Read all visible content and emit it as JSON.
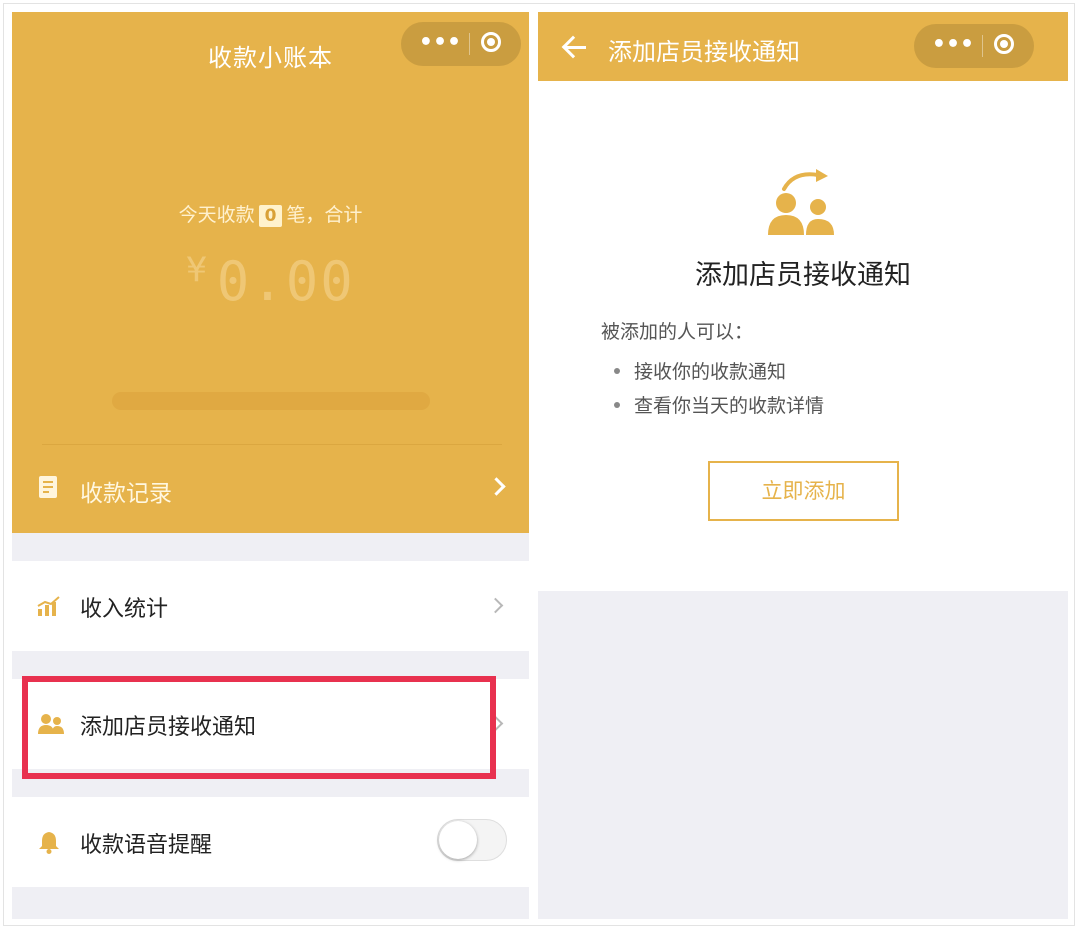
{
  "left_screen": {
    "title": "收款小账本",
    "capsule": {
      "more_label": "•••"
    },
    "today": {
      "prefix": "今天收款",
      "count": "0",
      "suffix": "笔，合计"
    },
    "amount": {
      "currency": "¥",
      "value": "0.00"
    },
    "records_label": "收款记录",
    "menu": {
      "income_stats": "收入统计",
      "add_staff": "添加店员接收通知",
      "voice_alert": "收款语音提醒"
    },
    "voice_toggle_on": false
  },
  "right_screen": {
    "nav_title": "添加店员接收通知",
    "capsule": {
      "more_label": "•••"
    },
    "heading": "添加店员接收通知",
    "sub_label": "被添加的人可以：",
    "bullets": [
      "接收你的收款通知",
      "查看你当天的收款详情"
    ],
    "button_label": "立即添加"
  },
  "colors": {
    "brand": "#e6b34b",
    "highlight": "#e8314f"
  }
}
